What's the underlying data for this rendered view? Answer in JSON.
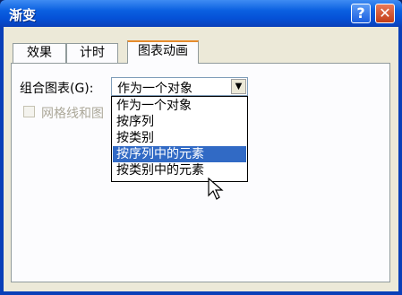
{
  "window": {
    "title": "渐变",
    "help_label": "?",
    "close_label": "✕"
  },
  "tabs": [
    {
      "label": "效果",
      "active": false
    },
    {
      "label": "计时",
      "active": false
    },
    {
      "label": "图表动画",
      "active": true
    }
  ],
  "chart_group": {
    "label": "组合图表(G):",
    "selected_value": "作为一个对象",
    "options": [
      "作为一个对象",
      "按序列",
      "按类别",
      "按序列中的元素",
      "按类别中的元素"
    ],
    "highlighted_option": "按序列中的元素"
  },
  "gridlines_checkbox": {
    "label": "网格线和图",
    "checked": false,
    "enabled": false
  },
  "colors": {
    "titlebar": "#0a5fe0",
    "selection": "#316ac5",
    "tab_accent": "#e68b2c"
  },
  "icons": {
    "help": "help-icon",
    "close": "close-icon",
    "dropdown": "chevron-down-icon",
    "cursor": "arrow-cursor-icon"
  }
}
